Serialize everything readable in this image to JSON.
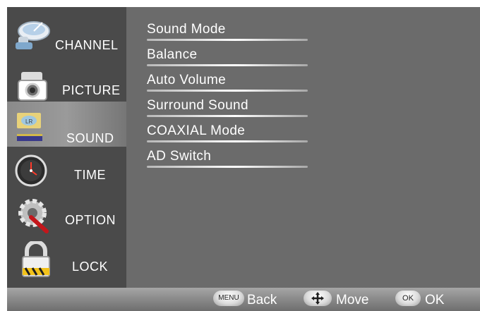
{
  "sidebar": {
    "items": [
      {
        "label": "CHANNEL",
        "icon": "satellite-dish-icon",
        "active": false
      },
      {
        "label": "PICTURE",
        "icon": "camera-icon",
        "active": false
      },
      {
        "label": "SOUND",
        "icon": "speaker-icon",
        "active": true
      },
      {
        "label": "TIME",
        "icon": "clock-icon",
        "active": false
      },
      {
        "label": "OPTION",
        "icon": "gear-icon",
        "active": false
      },
      {
        "label": "LOCK",
        "icon": "lock-icon",
        "active": false
      }
    ]
  },
  "menu": {
    "items": [
      {
        "label": "Sound Mode"
      },
      {
        "label": "Balance"
      },
      {
        "label": "Auto Volume"
      },
      {
        "label": "Surround Sound"
      },
      {
        "label": "COAXIAL Mode"
      },
      {
        "label": "AD Switch"
      }
    ]
  },
  "bottombar": {
    "menu_key": "MENU",
    "back_label": "Back",
    "move_label": "Move",
    "ok_key": "OK",
    "ok_label": "OK"
  },
  "colors": {
    "background": "#6b6b6b",
    "sidebar": "#4a4a4a",
    "text": "#ffffff"
  }
}
